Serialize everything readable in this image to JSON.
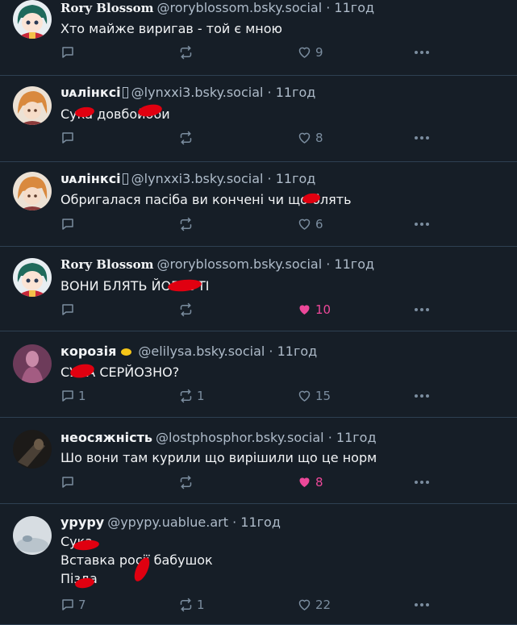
{
  "posts": [
    {
      "name": "Rory Blossom",
      "serif": true,
      "badge": "",
      "handle": "@roryblossom.bsky.social",
      "time": "11год",
      "text": "Хто майже виригав - той є мною",
      "reply_count": "",
      "repost_count": "",
      "like_count": "9",
      "liked": false,
      "avatar": "anime-girl-green-hair"
    },
    {
      "name": "ᴜᴀлінксі",
      "serif": false,
      "badge": "flag",
      "handle": "@lynxxi3.bsky.social",
      "time": "11год",
      "text": "Сука довбойоби",
      "reply_count": "",
      "repost_count": "",
      "like_count": "8",
      "liked": false,
      "avatar": "anime-girl-orange-hair"
    },
    {
      "name": "ᴜᴀлінксі",
      "serif": false,
      "badge": "flag",
      "handle": "@lynxxi3.bsky.social",
      "time": "11год",
      "text": "Обригалася пасіба ви кончені чи що блять",
      "reply_count": "",
      "repost_count": "",
      "like_count": "6",
      "liked": false,
      "avatar": "anime-girl-orange-hair"
    },
    {
      "name": "Rory Blossom",
      "serif": true,
      "badge": "",
      "handle": "@roryblossom.bsky.social",
      "time": "11год",
      "text": "ВОНИ БЛЯТЬ ЙОБНУТІ",
      "reply_count": "",
      "repost_count": "",
      "like_count": "10",
      "liked": true,
      "avatar": "anime-girl-green-hair"
    },
    {
      "name": "корозія",
      "serif": false,
      "badge": "emoji",
      "handle": "@elilysa.bsky.social",
      "time": "11год",
      "text": "СУКА СЕРЙОЗНО?",
      "reply_count": "1",
      "repost_count": "1",
      "like_count": "15",
      "liked": false,
      "avatar": "pink-photo-person"
    },
    {
      "name": "неосяжність",
      "serif": false,
      "badge": "",
      "handle": "@lostphosphor.bsky.social",
      "time": "11год",
      "text": "Шо вони там курили що вирішили що це норм",
      "reply_count": "",
      "repost_count": "",
      "like_count": "8",
      "liked": true,
      "avatar": "dark-photo-figure"
    },
    {
      "name": "уруру",
      "serif": false,
      "badge": "",
      "handle": "@ypypy.uablue.art",
      "time": "11год",
      "text": "Сука\nВставка росії бабушок\nПізда",
      "reply_count": "7",
      "repost_count": "1",
      "like_count": "22",
      "liked": false,
      "avatar": "light-photo-sky"
    }
  ],
  "colors": {
    "background": "#161e27",
    "divider": "#2e4052",
    "text": "#f1f3f5",
    "muted": "#aebbc9",
    "icon": "#7b8d9f",
    "like_active": "#ec4899",
    "redaction": "#e00010"
  },
  "icons": {
    "reply": "speech-bubble-icon",
    "repost": "repost-arrows-icon",
    "like": "heart-icon",
    "more": "more-dots-icon"
  }
}
